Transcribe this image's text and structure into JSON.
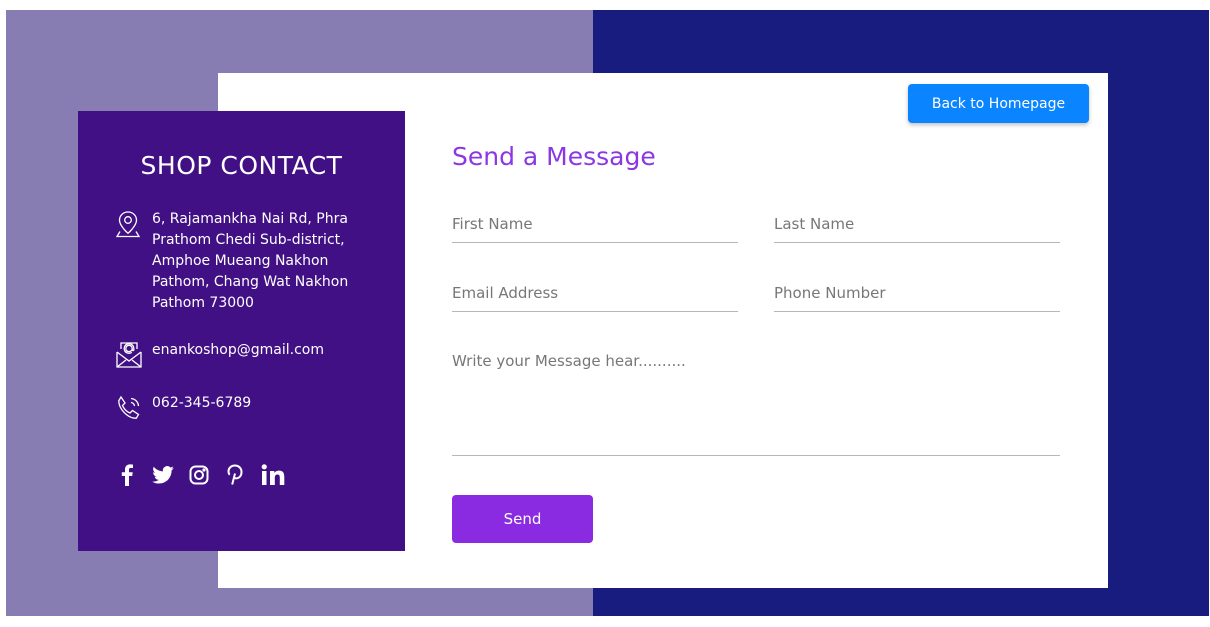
{
  "header": {
    "back_label": "Back to Homepage"
  },
  "contact": {
    "title": "SHOP CONTACT",
    "address": "6, Rajamankha Nai Rd, Phra Prathom Chedi Sub-district, Amphoe Mueang Nakhon Pathom, Chang Wat Nakhon Pathom 73000",
    "email": "enankoshop@gmail.com",
    "phone": "062-345-6789",
    "icons": {
      "address": "map-pin-icon",
      "email": "email-icon",
      "phone": "phone-icon"
    },
    "socials": [
      "facebook-icon",
      "twitter-icon",
      "instagram-icon",
      "pinterest-icon",
      "linkedin-icon"
    ]
  },
  "form": {
    "title": "Send a Message",
    "first_name_placeholder": "First Name",
    "last_name_placeholder": "Last Name",
    "email_placeholder": "Email Address",
    "phone_placeholder": "Phone Number",
    "message_placeholder": "Write your Message hear..........",
    "send_label": "Send"
  },
  "colors": {
    "left_bg": "#877db3",
    "right_bg": "#171c7e",
    "panel": "#421085",
    "accent": "#8a2be2",
    "back_button": "#0a84ff"
  }
}
